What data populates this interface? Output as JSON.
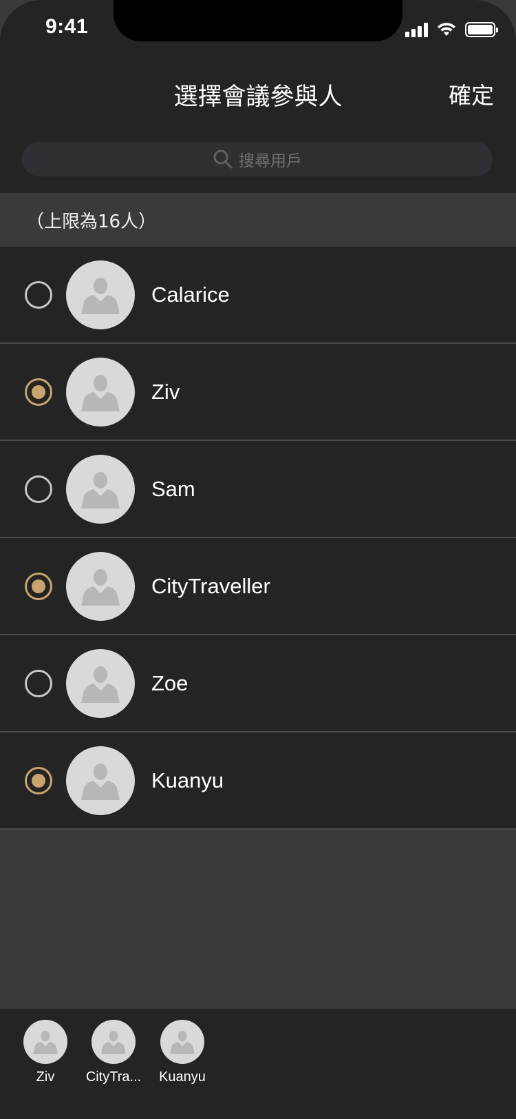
{
  "status_bar": {
    "time": "9:41"
  },
  "nav": {
    "title": "選擇會議參與人",
    "confirm_label": "確定"
  },
  "search": {
    "placeholder": "搜尋用戶"
  },
  "limit_note": "（上限為16人）",
  "colors": {
    "accent": "#c9a46c",
    "background": "#242424",
    "section": "#3a3a3a"
  },
  "icons": {
    "search": "search-icon",
    "avatar": "person-icon",
    "radio": "radio-button"
  },
  "participants": [
    {
      "name": "Calarice",
      "selected": false
    },
    {
      "name": "Ziv",
      "selected": true
    },
    {
      "name": "Sam",
      "selected": false
    },
    {
      "name": "CityTraveller",
      "selected": true
    },
    {
      "name": "Zoe",
      "selected": false
    },
    {
      "name": "Kuanyu",
      "selected": true
    }
  ],
  "selected_bar": [
    {
      "label": "Ziv"
    },
    {
      "label": "CityTra..."
    },
    {
      "label": "Kuanyu"
    }
  ]
}
